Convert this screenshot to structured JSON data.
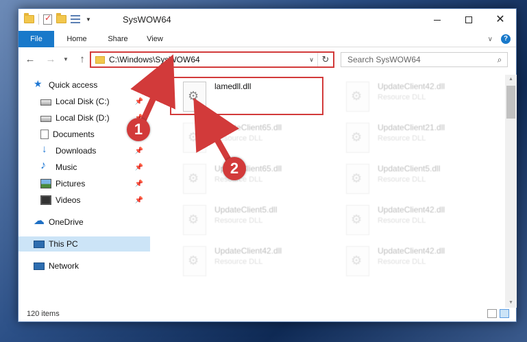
{
  "window": {
    "title": "SysWOW64"
  },
  "ribbon": {
    "tabs": [
      "File",
      "Home",
      "Share",
      "View"
    ]
  },
  "nav": {
    "address": "C:\\Windows\\SysWOW64",
    "search_placeholder": "Search SysWOW64"
  },
  "sidebar": {
    "items": [
      {
        "label": "Quick access",
        "icon": "star-icon",
        "pinned": false
      },
      {
        "label": "Local Disk (C:)",
        "icon": "disk-icon",
        "pinned": true
      },
      {
        "label": "Local Disk (D:)",
        "icon": "disk-icon",
        "pinned": true
      },
      {
        "label": "Documents",
        "icon": "documents-icon",
        "pinned": true
      },
      {
        "label": "Downloads",
        "icon": "downloads-icon",
        "pinned": true
      },
      {
        "label": "Music",
        "icon": "music-icon",
        "pinned": true
      },
      {
        "label": "Pictures",
        "icon": "pictures-icon",
        "pinned": true
      },
      {
        "label": "Videos",
        "icon": "videos-icon",
        "pinned": true
      },
      {
        "label": "OneDrive",
        "icon": "cloud-icon",
        "pinned": false
      },
      {
        "label": "This PC",
        "icon": "pc-icon",
        "pinned": false,
        "selected": true
      },
      {
        "label": "Network",
        "icon": "network-icon",
        "pinned": false
      }
    ]
  },
  "files": [
    {
      "name": "lamedll.dll",
      "type": "",
      "highlighted": true
    },
    {
      "name": "UpdateClient42.dll",
      "type": "Resource DLL"
    },
    {
      "name": "UpdateClient65.dll",
      "type": "Resource DLL"
    },
    {
      "name": "UpdateClient21.dll",
      "type": "Resource DLL"
    },
    {
      "name": "UpdateClient65.dll",
      "type": "Resource DLL"
    },
    {
      "name": "UpdateClient5.dll",
      "type": "Resource DLL"
    },
    {
      "name": "UpdateClient5.dll",
      "type": "Resource DLL"
    },
    {
      "name": "UpdateClient42.dll",
      "type": "Resource DLL"
    },
    {
      "name": "UpdateClient42.dll",
      "type": "Resource DLL"
    },
    {
      "name": "UpdateClient42.dll",
      "type": "Resource DLL"
    }
  ],
  "status": {
    "item_count": "120 items"
  },
  "annotations": {
    "step1": "1",
    "step2": "2"
  },
  "colors": {
    "accent": "#1979ca",
    "annotation": "#d23a3a",
    "selected": "#cce4f7"
  }
}
